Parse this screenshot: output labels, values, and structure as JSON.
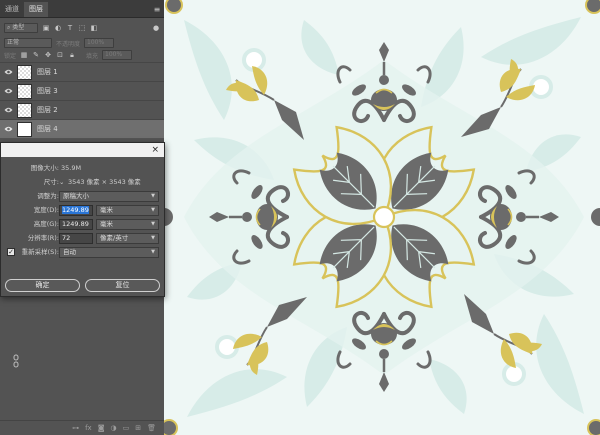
{
  "panel": {
    "tabs": [
      "通道",
      "图层"
    ],
    "active_tab": 1,
    "filter_kind_label": "类型",
    "blend_mode": "正常",
    "opacity_label": "不透明度",
    "opacity_value": "100%",
    "lock_label": "锁定",
    "fill_label": "填充",
    "fill_value": "100%",
    "layers": [
      {
        "name": "图层 1",
        "thumb": "transparent",
        "selected": false
      },
      {
        "name": "图层 3",
        "thumb": "transparent",
        "selected": false
      },
      {
        "name": "图层 2",
        "thumb": "transparent",
        "selected": false
      },
      {
        "name": "图层 4",
        "thumb": "white",
        "selected": true
      }
    ]
  },
  "dialog": {
    "close_label": "×",
    "image_size_label": "图像大小:",
    "image_size_value": "35.9M",
    "dimensions_label": "尺寸:",
    "dimensions_value": "3543 像素 × 3543 像素",
    "fit_label": "调整为:",
    "fit_value": "原稿大小",
    "width_label": "宽度(D):",
    "width_value": "1249.89",
    "width_unit": "毫米",
    "height_label": "高度(G):",
    "height_value": "1249.89",
    "height_unit": "毫米",
    "resolution_label": "分辨率(R):",
    "resolution_value": "72",
    "resolution_unit": "像素/英寸",
    "resample_label": "重新采样(S):",
    "resample_value": "自动",
    "ok_label": "确定",
    "cancel_label": "复位"
  },
  "colors": {
    "panel_bg": "#535353",
    "mint": "#cfe9e4",
    "gray": "#6b6b6b",
    "gold": "#d8c35a",
    "canvas_bg": "#eef7f5"
  }
}
